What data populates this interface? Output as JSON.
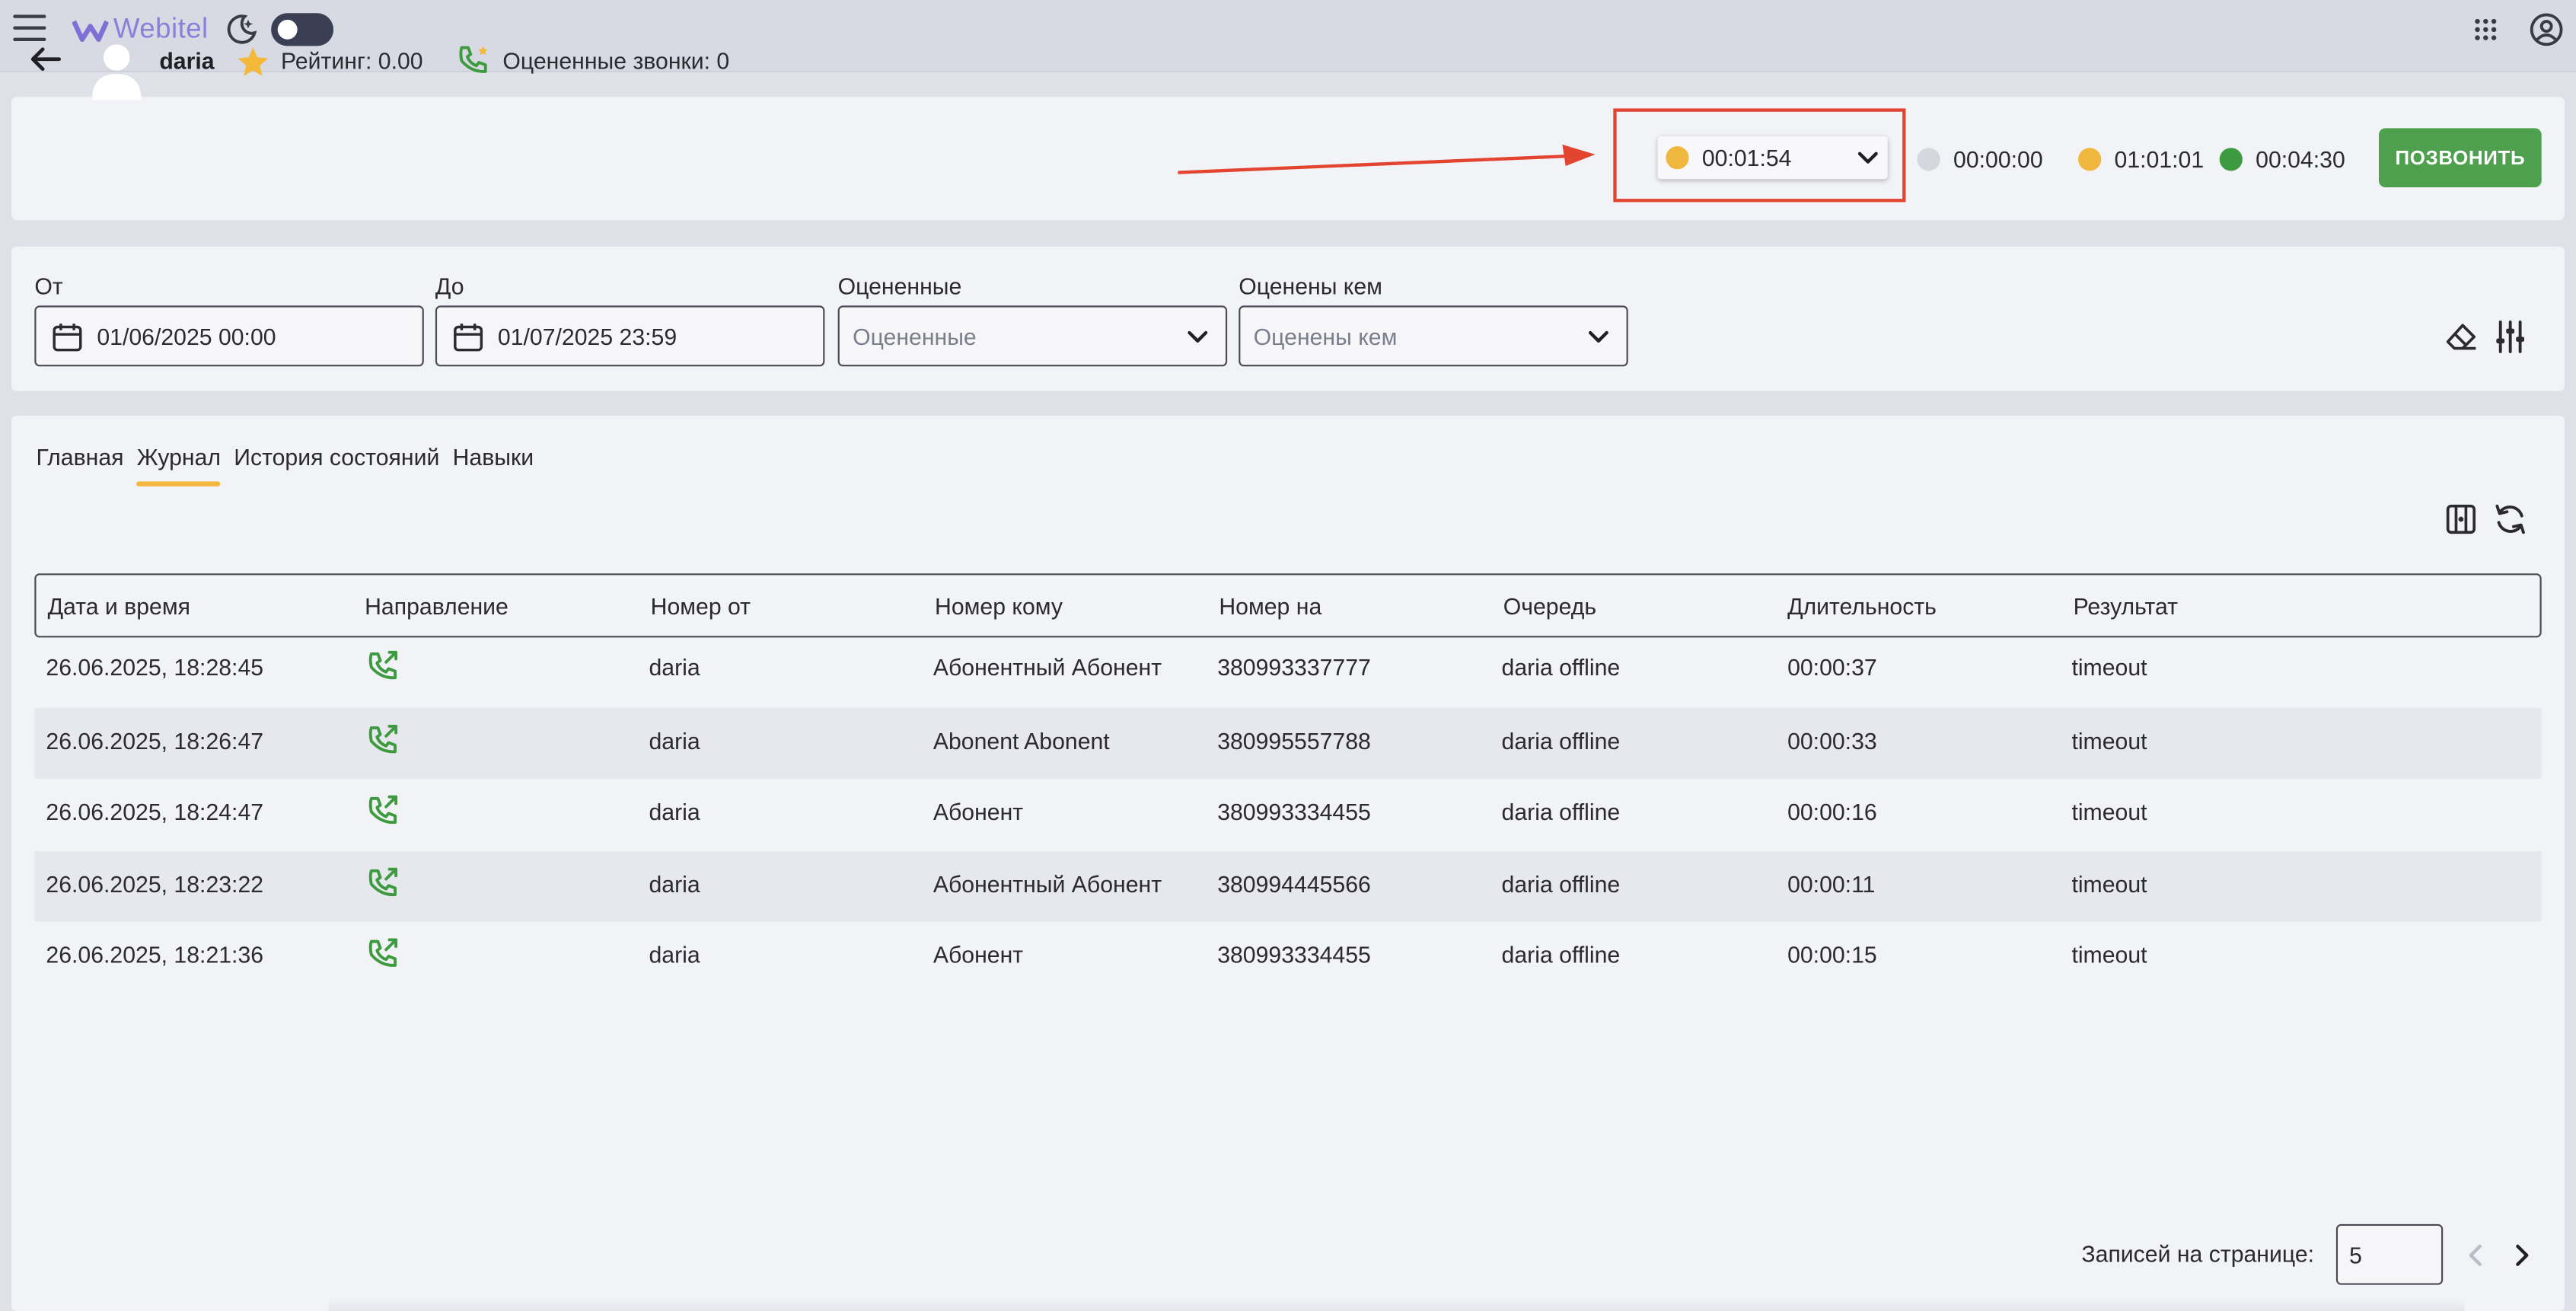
{
  "topbar": {
    "logo_text": "Webitel",
    "menu_icon": "hamburger-menu-icon",
    "theme_icon": "moon-icon",
    "apps_icon": "apps-grid-icon",
    "account_icon": "account-circle-icon"
  },
  "agent": {
    "name": "daria",
    "rating": "Рейтинг: 0.00",
    "rated_calls": "Оцененные звонки: 0",
    "status": {
      "current_time": "00:01:54",
      "current_color": "#f0b73e"
    },
    "timers": [
      {
        "value": "00:00:00",
        "color": "#d6d7de"
      },
      {
        "value": "01:01:01",
        "color": "#f0b73e"
      },
      {
        "value": "00:04:30",
        "color": "#3e9a3f"
      }
    ],
    "call_button": "ПОЗВОНИТЬ",
    "highlight_color": "#e2442f"
  },
  "filters": {
    "from": {
      "label": "От",
      "value": "01/06/2025 00:00"
    },
    "to": {
      "label": "До",
      "value": "01/07/2025 23:59"
    },
    "rated": {
      "label": "Оцененные",
      "placeholder": "Оцененные"
    },
    "rated_by": {
      "label": "Оценены кем",
      "placeholder": "Оценены кем"
    }
  },
  "tabs": [
    "Главная",
    "Журнал",
    "История состояний",
    "Навыки"
  ],
  "active_tab": "Журнал",
  "table": {
    "columns": [
      "Дата и время",
      "Направление",
      "Номер от",
      "Номер кому",
      "Номер на",
      "Очередь",
      "Длительность",
      "Результат"
    ],
    "rows": [
      {
        "datetime": "26.06.2025, 18:28:45",
        "direction_icon": "outbound-call-icon",
        "from": "daria",
        "to": "Абонентный Абонент",
        "number": "380993337777",
        "queue": "daria offline",
        "duration": "00:00:37",
        "result": "timeout"
      },
      {
        "datetime": "26.06.2025, 18:26:47",
        "direction_icon": "outbound-call-icon",
        "from": "daria",
        "to": "Abonent Abonent",
        "number": "380995557788",
        "queue": "daria offline",
        "duration": "00:00:33",
        "result": "timeout"
      },
      {
        "datetime": "26.06.2025, 18:24:47",
        "direction_icon": "outbound-call-icon",
        "from": "daria",
        "to": "Абонент",
        "number": "380993334455",
        "queue": "daria offline",
        "duration": "00:00:16",
        "result": "timeout"
      },
      {
        "datetime": "26.06.2025, 18:23:22",
        "direction_icon": "outbound-call-icon",
        "from": "daria",
        "to": "Абонентный Абонент",
        "number": "380994445566",
        "queue": "daria offline",
        "duration": "00:00:11",
        "result": "timeout"
      },
      {
        "datetime": "26.06.2025, 18:21:36",
        "direction_icon": "outbound-call-icon",
        "from": "daria",
        "to": "Абонент",
        "number": "380993334455",
        "queue": "daria offline",
        "duration": "00:00:15",
        "result": "timeout"
      }
    ]
  },
  "pagination": {
    "label": "Записей на странице:",
    "page_size": "5"
  }
}
